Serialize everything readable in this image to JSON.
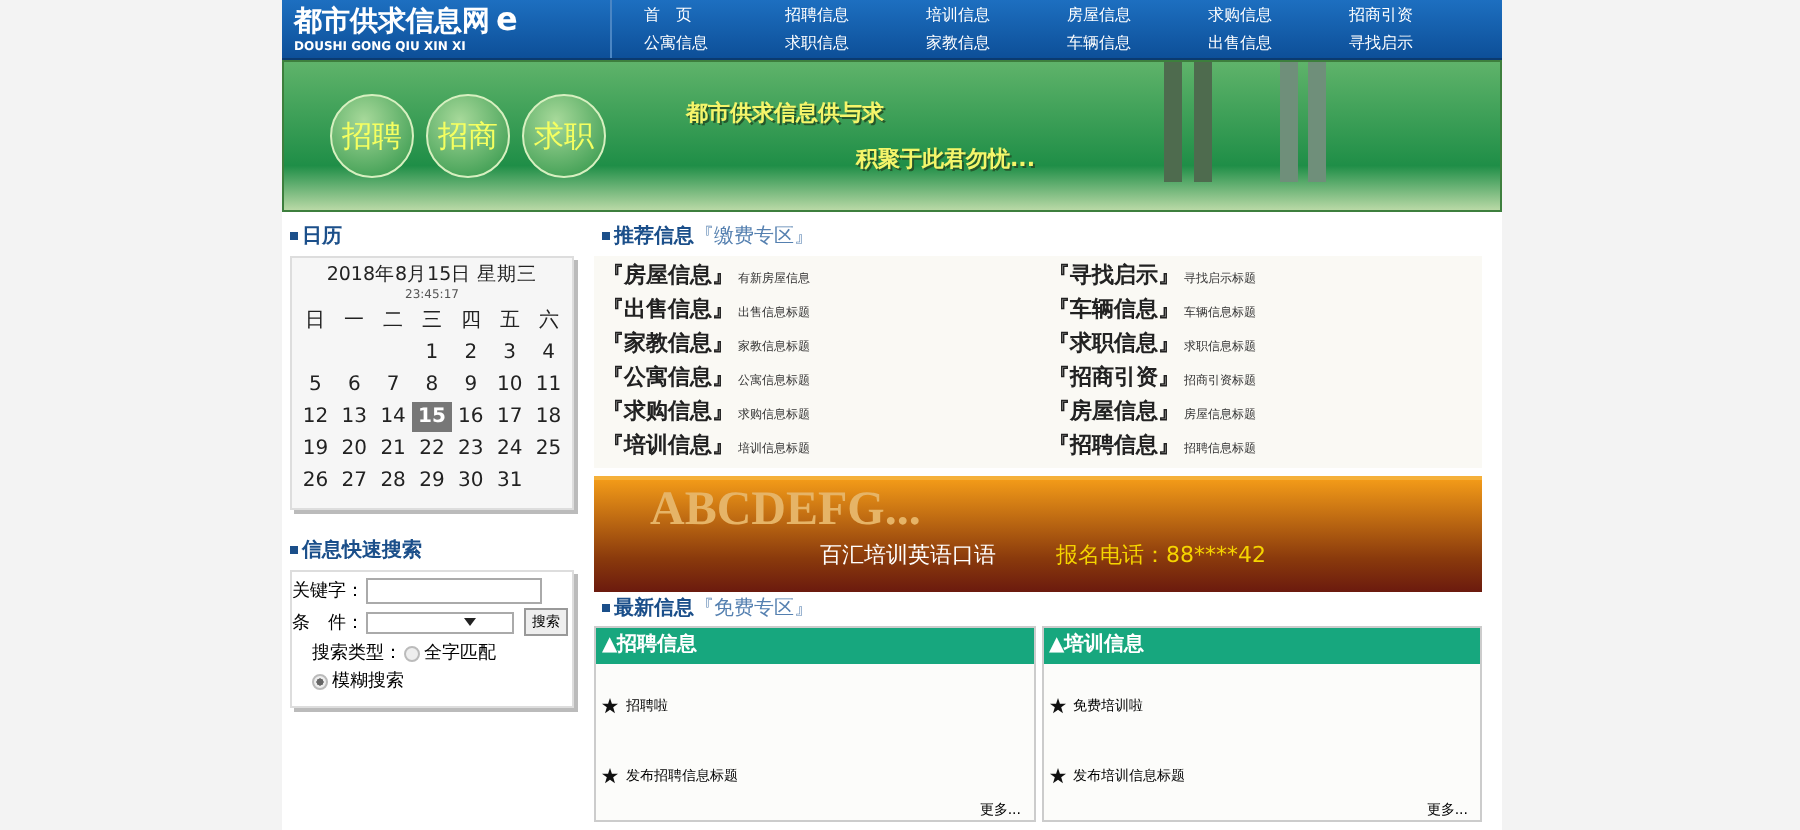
{
  "header": {
    "logo": "都市供求信息网",
    "logo_mark": "e",
    "logo_sub": "DOUSHI GONG QIU XIN XI",
    "nav": [
      "首　页",
      "招聘信息",
      "培训信息",
      "房屋信息",
      "求购信息",
      "招商引资",
      "公寓信息",
      "求职信息",
      "家教信息",
      "车辆信息",
      "出售信息",
      "寻找启示"
    ]
  },
  "banner": {
    "buttons": [
      "招聘",
      "招商",
      "求职"
    ],
    "slogan": [
      "都市供求信息供与求",
      "积聚于此君勿忧..."
    ]
  },
  "calendar": {
    "title": "日历",
    "date": "2018年8月15日 星期三",
    "time": "23:45:17",
    "weekdays": [
      "日",
      "一",
      "二",
      "三",
      "四",
      "五",
      "六"
    ],
    "weeks": [
      [
        {
          "day": "1",
          "selected": false
        },
        {
          "day": "2",
          "selected": false
        },
        {
          "day": "3",
          "selected": false
        },
        {
          "day": "4",
          "selected": false
        }
      ],
      [
        {
          "day": "5",
          "selected": false
        },
        {
          "day": "6",
          "selected": false
        },
        {
          "day": "7",
          "selected": false
        },
        {
          "day": "8",
          "selected": false
        },
        {
          "day": "9",
          "selected": false
        },
        {
          "day": "10",
          "selected": false
        },
        {
          "day": "11",
          "selected": false
        }
      ],
      [
        {
          "day": "12",
          "selected": false
        },
        {
          "day": "13",
          "selected": false
        },
        {
          "day": "14",
          "selected": false
        },
        {
          "day": "15",
          "selected": true
        },
        {
          "day": "16",
          "selected": false
        },
        {
          "day": "17",
          "selected": false
        },
        {
          "day": "18",
          "selected": false
        }
      ],
      [
        {
          "day": "19",
          "selected": false
        },
        {
          "day": "20",
          "selected": false
        },
        {
          "day": "21",
          "selected": false
        },
        {
          "day": "22",
          "selected": false
        },
        {
          "day": "23",
          "selected": false
        },
        {
          "day": "24",
          "selected": false
        },
        {
          "day": "25",
          "selected": false
        }
      ],
      [
        {
          "day": "26",
          "selected": false
        },
        {
          "day": "27",
          "selected": false
        },
        {
          "day": "28",
          "selected": false
        },
        {
          "day": "29",
          "selected": false
        },
        {
          "day": "30",
          "selected": false
        },
        {
          "day": "31",
          "selected": false
        }
      ]
    ]
  },
  "search": {
    "title": "信息快速搜索",
    "keyword_label": "关键字：",
    "condition_label": "条　件：",
    "button": "搜索",
    "type_label": "搜索类型：",
    "options": [
      {
        "label": "全字匹配",
        "selected": false
      },
      {
        "label": "模糊搜索",
        "selected": true
      }
    ]
  },
  "recommend": {
    "title": "推荐信息",
    "zone": "『缴费专区』",
    "items": [
      {
        "category": "『房屋信息』",
        "text": "有新房屋信息"
      },
      {
        "category": "『寻找启示』",
        "text": "寻找启示标题"
      },
      {
        "category": "『出售信息』",
        "text": "出售信息标题"
      },
      {
        "category": "『车辆信息』",
        "text": "车辆信息标题"
      },
      {
        "category": "『家教信息』",
        "text": "家教信息标题"
      },
      {
        "category": "『求职信息』",
        "text": "求职信息标题"
      },
      {
        "category": "『公寓信息』",
        "text": "公寓信息标题"
      },
      {
        "category": "『招商引资』",
        "text": "招商引资标题"
      },
      {
        "category": "『求购信息』",
        "text": "求购信息标题"
      },
      {
        "category": "『房屋信息』",
        "text": "房屋信息标题"
      },
      {
        "category": "『培训信息』",
        "text": "培训信息标题"
      },
      {
        "category": "『招聘信息』",
        "text": "招聘信息标题"
      }
    ]
  },
  "ad": {
    "headline": "ABCDEFG...",
    "text": "百汇培训英语口语",
    "phone": "报名电话：88****42"
  },
  "latest": {
    "title": "最新信息",
    "zone": "『免费专区』",
    "panels": [
      {
        "title": "▲招聘信息",
        "items": [
          "招聘啦",
          "发布招聘信息标题"
        ],
        "more": "更多..."
      },
      {
        "title": "▲培训信息",
        "items": [
          "免费培训啦",
          "发布培训信息标题"
        ],
        "more": "更多..."
      }
    ]
  }
}
